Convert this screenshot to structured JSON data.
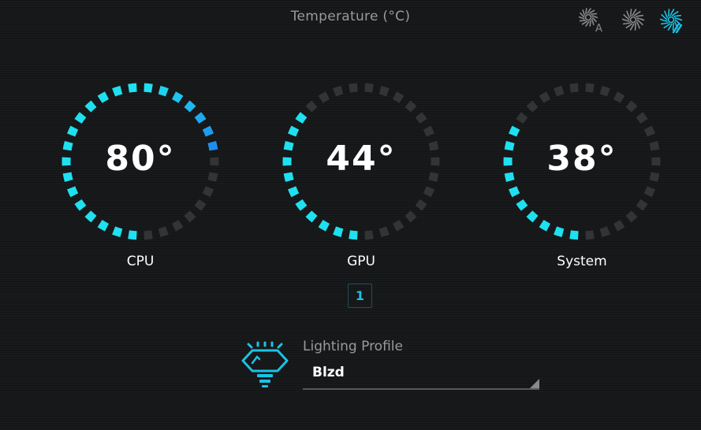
{
  "header": {
    "title": "Temperature (°C)"
  },
  "fan_modes": [
    {
      "name": "auto",
      "icon": "fan-auto-icon",
      "active": false
    },
    {
      "name": "max",
      "icon": "fan-max-icon",
      "active": false
    },
    {
      "name": "custom",
      "icon": "fan-custom-icon",
      "active": true
    }
  ],
  "gauges": [
    {
      "label": "CPU",
      "display": "80°",
      "level": 0.72
    },
    {
      "label": "GPU",
      "display": "44°",
      "level": 0.38
    },
    {
      "label": "System",
      "display": "38°",
      "level": 0.32
    }
  ],
  "pager": {
    "current": "1"
  },
  "lighting": {
    "label": "Lighting Profile",
    "value": "Blzd"
  },
  "colors": {
    "background": "#161718",
    "accent": "#19c3e6",
    "gauge_low": "#1ee0f0",
    "gauge_high": "#1d3cf0",
    "gauge_inactive": "#323436",
    "icon_inactive": "#8a8a8a",
    "muted_text": "#9a9a9a"
  }
}
